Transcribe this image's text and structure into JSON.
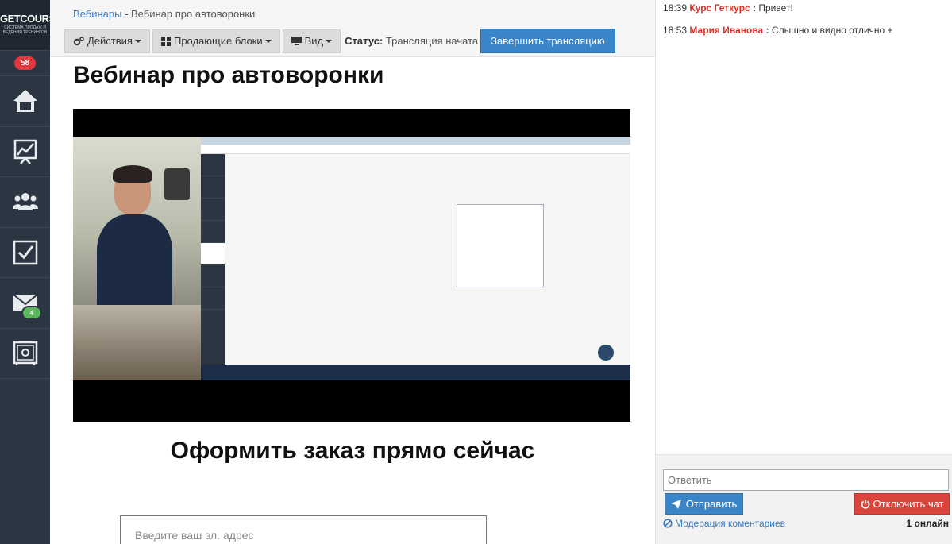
{
  "sidebar": {
    "logo_title": "GETCOURSE",
    "logo_subtitle": "СИСТЕМА ПРОДАЖ И ВЕДЕНИЯ ТРЕНИНГОВ",
    "notifications_count": "58",
    "items": [
      {
        "icon": "home-icon"
      },
      {
        "icon": "chart-icon"
      },
      {
        "icon": "users-icon"
      },
      {
        "icon": "tasks-icon"
      },
      {
        "icon": "mail-icon",
        "badge": "4"
      },
      {
        "icon": "safe-icon"
      }
    ]
  },
  "breadcrumb": {
    "link": "Вебинары",
    "separator": " - ",
    "current": "Вебинар про автоворонки"
  },
  "toolbar": {
    "actions_label": "Действия",
    "blocks_label": "Продающие блоки",
    "view_label": "Вид",
    "status_label": "Статус:",
    "status_value": "Трансляция начата",
    "finish_label": "Завершить трансляцию"
  },
  "page": {
    "title": "Вебинар про автоворонки",
    "order_title": "Оформить заказ прямо сейчас",
    "email_placeholder": "Введите ваш эл. адрес"
  },
  "chat": {
    "messages": [
      {
        "time": "18:39",
        "author": "Курс Геткурс",
        "text": "Привет!"
      },
      {
        "time": "18:53",
        "author": "Мария Иванова",
        "text": "Слышно и видно отлично +"
      }
    ],
    "reply_placeholder": "Ответить",
    "send_label": "Отправить",
    "disable_label": "Отключить чат",
    "moderation_label": "Модерация коментариев",
    "online_count": "1 онлайн"
  },
  "colors": {
    "sidebar_bg": "#2b3642",
    "accent_blue": "#3a84c8",
    "danger_red": "#d9443c",
    "author_red": "#d9342b"
  }
}
